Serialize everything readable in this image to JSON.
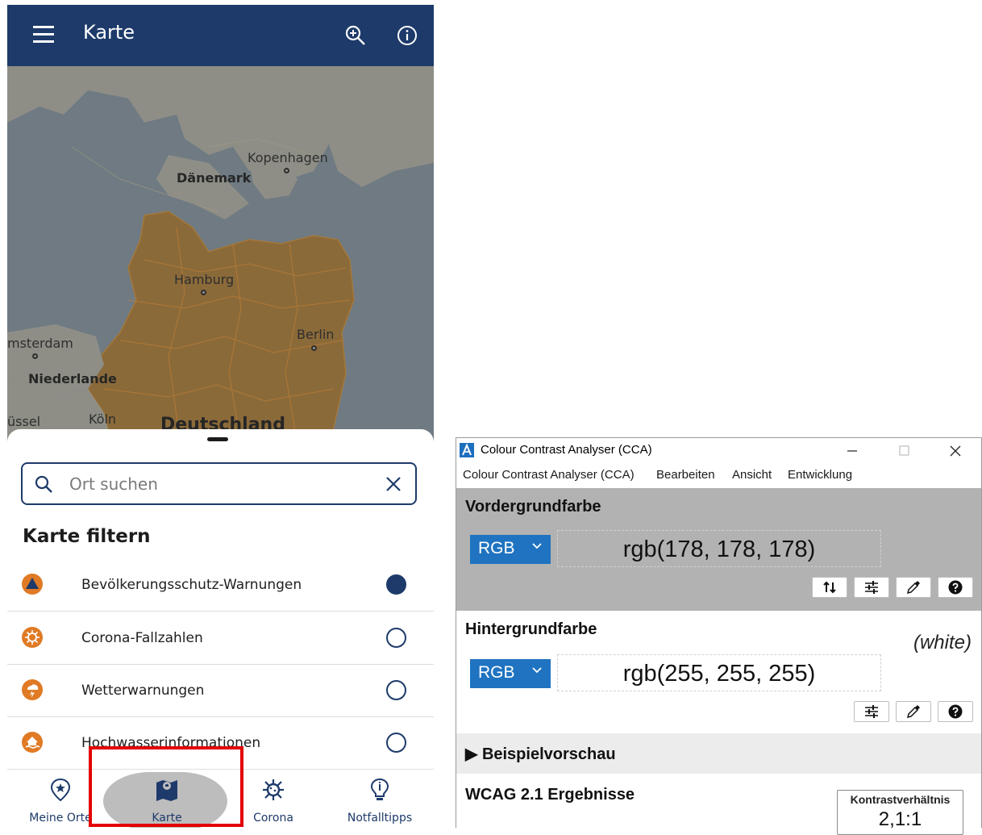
{
  "app": {
    "title": "Karte",
    "menu_icon": "menu-icon",
    "zoom_icon": "zoom-in-icon",
    "info_icon": "info-icon"
  },
  "map": {
    "labels": {
      "kopenhagen": "Kopenhagen",
      "daenemark": "Dänemark",
      "hamburg": "Hamburg",
      "berlin": "Berlin",
      "amsterdam": "msterdam",
      "niederlande": "Niederlande",
      "koeln": "Köln",
      "bruessel": "üssel",
      "deutschland": "Deutschland"
    }
  },
  "sheet": {
    "search_placeholder": "Ort suchen",
    "filter_title": "Karte filtern",
    "filters": [
      {
        "label": "Bevölkerungsschutz-Warnungen",
        "icon": "warning-triangle-icon",
        "selected": true
      },
      {
        "label": "Corona-Fallzahlen",
        "icon": "virus-icon",
        "selected": false
      },
      {
        "label": "Wetterwarnungen",
        "icon": "weather-icon",
        "selected": false
      },
      {
        "label": "Hochwasserinformationen",
        "icon": "flood-icon",
        "selected": false
      }
    ]
  },
  "bottom_nav": [
    {
      "label": "Meine Orte",
      "icon": "location-star-icon"
    },
    {
      "label": "Karte",
      "icon": "map-pin-icon",
      "active": true
    },
    {
      "label": "Corona",
      "icon": "virus-icon"
    },
    {
      "label": "Notfalltipps",
      "icon": "lightbulb-icon"
    }
  ],
  "cca": {
    "window_title": "Colour Contrast Analyser (CCA)",
    "menu": [
      "Colour Contrast Analyser (CCA)",
      "Bearbeiten",
      "Ansicht",
      "Entwicklung"
    ],
    "foreground": {
      "title": "Vordergrundfarbe",
      "format": "RGB",
      "value": "rgb(178, 178, 178)",
      "color": "#b2b2b2"
    },
    "background": {
      "title": "Hintergrundfarbe",
      "format": "RGB",
      "value": "rgb(255, 255, 255)",
      "name": "(white)",
      "color": "#ffffff"
    },
    "preview_label": "Beispielvorschau",
    "wcag_title": "WCAG 2.1 Ergebnisse",
    "ratio_label": "Kontrastverhältnis",
    "ratio_value": "2,1:1"
  },
  "colors": {
    "brand_navy": "#1d3a6a",
    "warning_orange": "#e07a24",
    "highlight_red": "#e30000",
    "cca_blue": "#1f73c1"
  }
}
